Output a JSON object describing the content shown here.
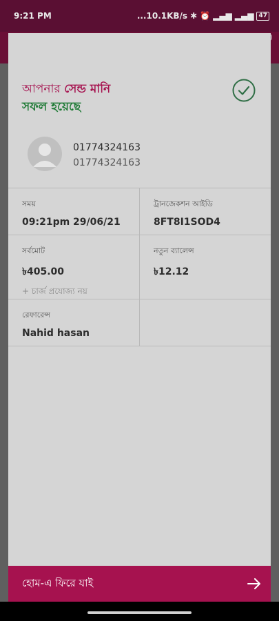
{
  "status_bar": {
    "time": "9:21 PM",
    "net_speed": "...10.1KB/s",
    "battery": "47",
    "icons": [
      "bluetooth-icon",
      "alarm-icon",
      "signal-icon",
      "signal-4g-icon",
      "battery-icon"
    ]
  },
  "dialog": {
    "title_part1": "আপনার ",
    "title_part2": "সেন্ড মানি",
    "title_part3": "সফল হয়েছে",
    "recipient_name": "01774324163",
    "recipient_number": "01774324163",
    "time_label": "সময়",
    "time_value": "09:21pm 29/06/21",
    "trx_label": "ট্রানজেকশন আইডি",
    "trx_value": "8FT8I1SOD4",
    "total_label": "সর্বমোট",
    "total_value": "৳405.00",
    "charge_note": "+ চার্জ প্রযোজ্য নয়",
    "new_balance_label": "নতুন ব্যালেন্স",
    "new_balance_value": "৳12.12",
    "reference_label": "রেফারেন্স",
    "reference_value": "Nahid hasan"
  },
  "home_button": {
    "label": "হোম-এ ফিরে যাই"
  },
  "colors": {
    "accent": "#a6124f",
    "success": "#1e7a35"
  }
}
